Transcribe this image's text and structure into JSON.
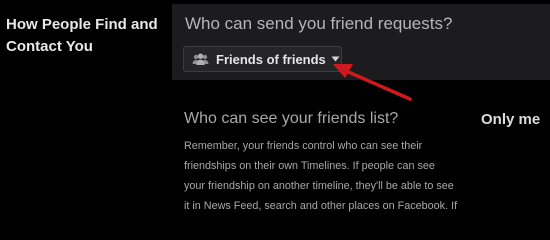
{
  "section": {
    "title_line1": "How People Find and",
    "title_line2": "Contact You"
  },
  "friend_requests": {
    "question": "Who can send you friend requests?",
    "dropdown": {
      "icon": "friends-icon",
      "selected": "Friends of friends",
      "chevron": "chevron-down-icon"
    }
  },
  "friends_list": {
    "question": "Who can see your friends list?",
    "value": "Only me",
    "description_lines": [
      "Remember, your friends control who can see their",
      "friendships on their own Timelines. If people can see",
      "your friendship on another timeline, they'll be able to see",
      "it in News Feed, search and other places on Facebook. If"
    ]
  },
  "annotation": {
    "arrow_color": "#d0191e"
  }
}
